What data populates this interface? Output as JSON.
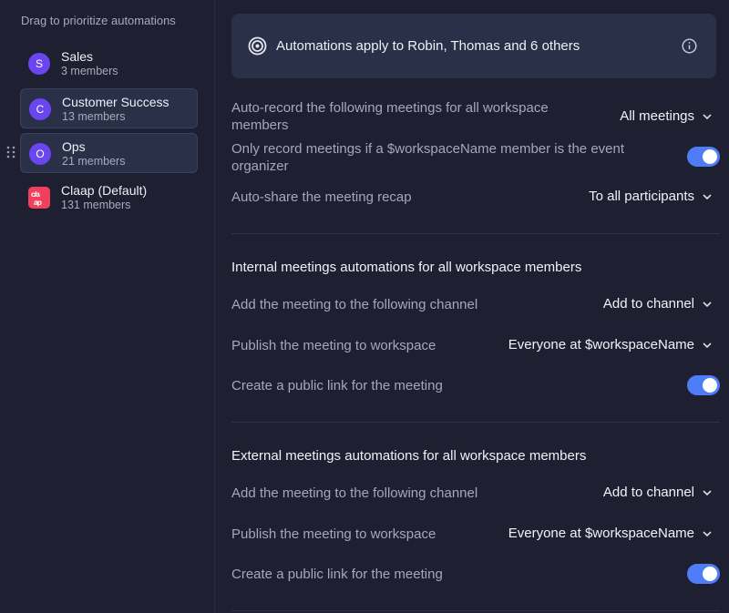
{
  "sidebar": {
    "title": "Drag to prioritize automations",
    "teams": [
      {
        "initial": "S",
        "name": "Sales",
        "members": "3 members"
      },
      {
        "initial": "C",
        "name": "Customer Success",
        "members": "13 members"
      },
      {
        "initial": "O",
        "name": "Ops",
        "members": "21 members"
      },
      {
        "initial": "c/a ap",
        "name": "Claap (Default)",
        "members": "131 members"
      }
    ]
  },
  "banner": {
    "text": "Automations apply to Robin, Thomas and 6 others"
  },
  "general": {
    "auto_record_label": "Auto-record the following meetings for all workspace members",
    "auto_record_value": "All meetings",
    "only_record_label": "Only record meetings if a $workspaceName member is the event organizer",
    "only_record_enabled": true,
    "auto_share_label": "Auto-share the meeting recap",
    "auto_share_value": "To all participants"
  },
  "internal": {
    "title": "Internal meetings automations for all workspace members",
    "channel_label": "Add the meeting to the following channel",
    "channel_value": "Add to channel",
    "publish_label": "Publish the meeting to workspace",
    "publish_value": "Everyone at $workspaceName",
    "public_link_label": "Create a public link for the meeting",
    "public_link_enabled": true
  },
  "external": {
    "title": "External meetings automations for all workspace members",
    "channel_label": "Add the meeting to the following channel",
    "channel_value": "Add to channel",
    "publish_label": "Publish the meeting to workspace",
    "publish_value": "Everyone at $workspaceName",
    "public_link_label": "Create a public link for the meeting",
    "public_link_enabled": true
  },
  "colors": {
    "background": "#1e2031",
    "card": "#2b3049",
    "accent": "#4f7cf7",
    "avatar": "#6a45f0",
    "logo": "#f0405c"
  }
}
